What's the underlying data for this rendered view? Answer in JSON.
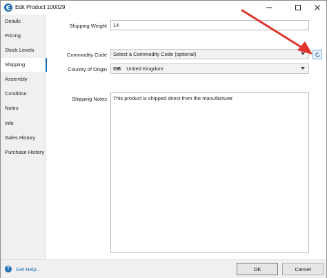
{
  "window": {
    "title": "Edit Product 100029"
  },
  "sidebar": {
    "items": [
      {
        "label": "Details"
      },
      {
        "label": "Pricing"
      },
      {
        "label": "Stock Levels"
      },
      {
        "label": "Shipping"
      },
      {
        "label": "Assembly"
      },
      {
        "label": "Condition"
      },
      {
        "label": "Notes"
      },
      {
        "label": "Info"
      },
      {
        "label": "Sales History"
      },
      {
        "label": "Purchase History"
      }
    ],
    "active": "Shipping"
  },
  "form": {
    "shipping_weight_label": "Shipping Weight",
    "shipping_weight_value": "14",
    "commodity_code_label": "Commodity Code",
    "commodity_code_value": "Select a Commodity Code (optional)",
    "country_label": "Country of Origin",
    "country_code": "GB",
    "country_name": "United Kingdom",
    "notes_label": "Shipping Notes",
    "notes_value": "This product is shipped direct from the manufacturer"
  },
  "footer": {
    "help_label": "Get Help...",
    "ok_label": "OK",
    "cancel_label": "Cancel"
  },
  "colors": {
    "accent": "#1f6fb2",
    "annotation_arrow": "#e0342c"
  },
  "icons": {
    "app": "app-logo-icon",
    "refresh": "refresh-icon",
    "help": "help-icon"
  }
}
